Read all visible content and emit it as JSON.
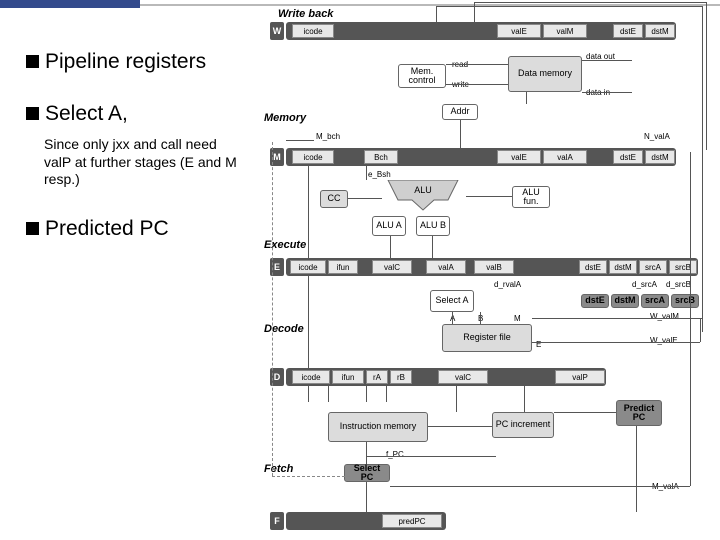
{
  "left_panel": {
    "bullets": [
      "Pipeline registers",
      "Select A,",
      "Predicted PC"
    ],
    "subtext": "Since only jxx and call need valP at further stages (E and M resp.)"
  },
  "stages": {
    "writeback": "Write back",
    "memory": "Memory",
    "execute": "Execute",
    "decode": "Decode",
    "fetch": "Fetch"
  },
  "reg_labels": {
    "W": "W",
    "M": "M",
    "E": "E",
    "D": "D",
    "F": "F"
  },
  "W_cells": [
    "icode",
    "valE",
    "valM",
    "dstE",
    "dstM"
  ],
  "M_cells": [
    "icode",
    "Bch",
    "valE",
    "valA",
    "dstE",
    "dstM"
  ],
  "E_cells": [
    "icode",
    "ifun",
    "valC",
    "valA",
    "valB",
    "dstE",
    "dstM",
    "srcA",
    "srcB"
  ],
  "E_dark": [
    "dstE",
    "dstM",
    "srcA",
    "srcB"
  ],
  "D_cells": [
    "icode",
    "ifun",
    "rA",
    "rB",
    "valC",
    "valP"
  ],
  "F_cells": [
    "predPC"
  ],
  "blocks": {
    "data_mem": "Data memory",
    "mem_ctrl": "Mem. control",
    "addr": "Addr",
    "cc": "CC",
    "alu": "ALU",
    "alu_a": "ALU A",
    "alu_b": "ALU B",
    "alu_fun": "ALU fun.",
    "select_a": "Select A",
    "reg_file": "Register file",
    "instr_mem": "Instruction memory",
    "pc_incr": "PC increment",
    "predict_pc": "Predict PC",
    "select_pc": "Select PC"
  },
  "signals": {
    "read": "read",
    "write": "write",
    "data_out": "data out",
    "data_in": "data in",
    "m_bch": "M_bch",
    "n_vala": "N_valA",
    "e_bch": "e_Bsh",
    "rf_a": "A",
    "rf_b": "B",
    "rf_m": "M",
    "rf_e": "E",
    "d_rvala": "d_rvalA",
    "d_srca": "d_srcA",
    "d_srcb": "d_srcB",
    "w_valm": "W_valM",
    "w_vale": "W_valE",
    "f_pc": "f_PC",
    "m_vala": "M_valA"
  }
}
